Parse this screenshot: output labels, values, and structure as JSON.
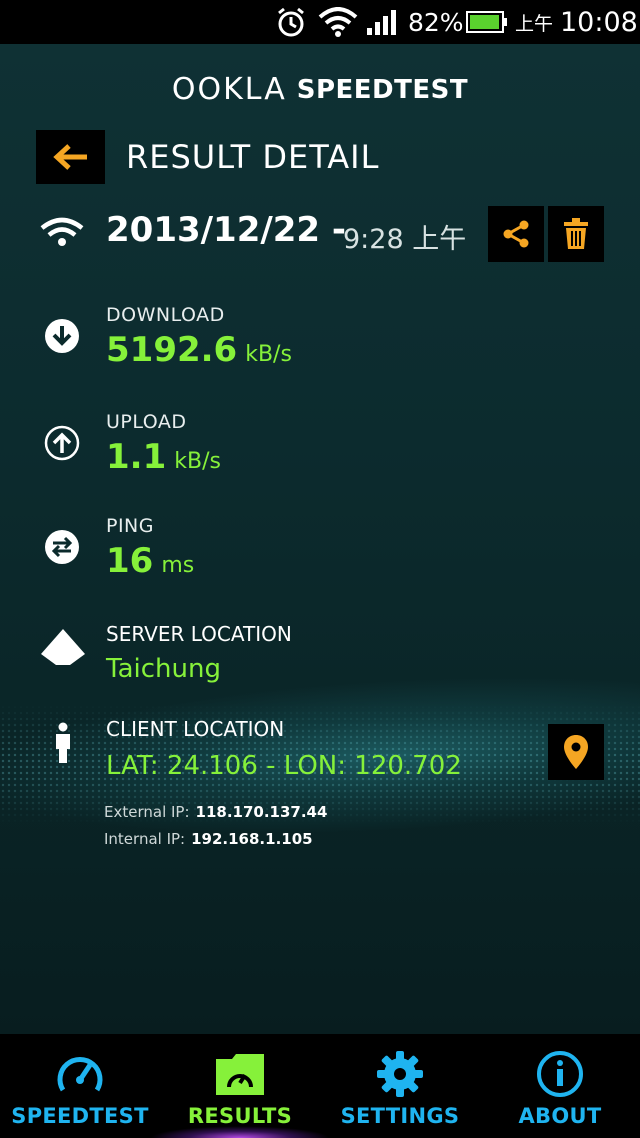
{
  "status_bar": {
    "battery_percent": "82%",
    "ampm": "上午",
    "time": "10:08"
  },
  "header": {
    "brand_left": "OOKLA",
    "brand_right": "SPEEDTEST",
    "title": "RESULT DETAIL"
  },
  "result": {
    "date": "2013/12/22 -",
    "time": "9:28 上午"
  },
  "metrics": {
    "download": {
      "label": "DOWNLOAD",
      "value": "5192.6",
      "unit": "kB/s"
    },
    "upload": {
      "label": "UPLOAD",
      "value": "1.1",
      "unit": "kB/s"
    },
    "ping": {
      "label": "PING",
      "value": "16",
      "unit": "ms"
    }
  },
  "server": {
    "label": "SERVER LOCATION",
    "value": "Taichung"
  },
  "client": {
    "label": "CLIENT LOCATION",
    "value": "LAT: 24.106 - LON: 120.702",
    "external_ip_label": "External IP:",
    "external_ip": "118.170.137.44",
    "internal_ip_label": "Internal IP:",
    "internal_ip": "192.168.1.105"
  },
  "nav": {
    "items": [
      {
        "label": "SPEEDTEST",
        "color": "#1fb4f0"
      },
      {
        "label": "RESULTS",
        "color": "#86f13a",
        "active": true
      },
      {
        "label": "SETTINGS",
        "color": "#1fb4f0"
      },
      {
        "label": "ABOUT",
        "color": "#1fb4f0"
      }
    ]
  },
  "colors": {
    "accent_green": "#86f13a",
    "accent_orange": "#f5a623",
    "accent_blue": "#1fb4f0"
  }
}
